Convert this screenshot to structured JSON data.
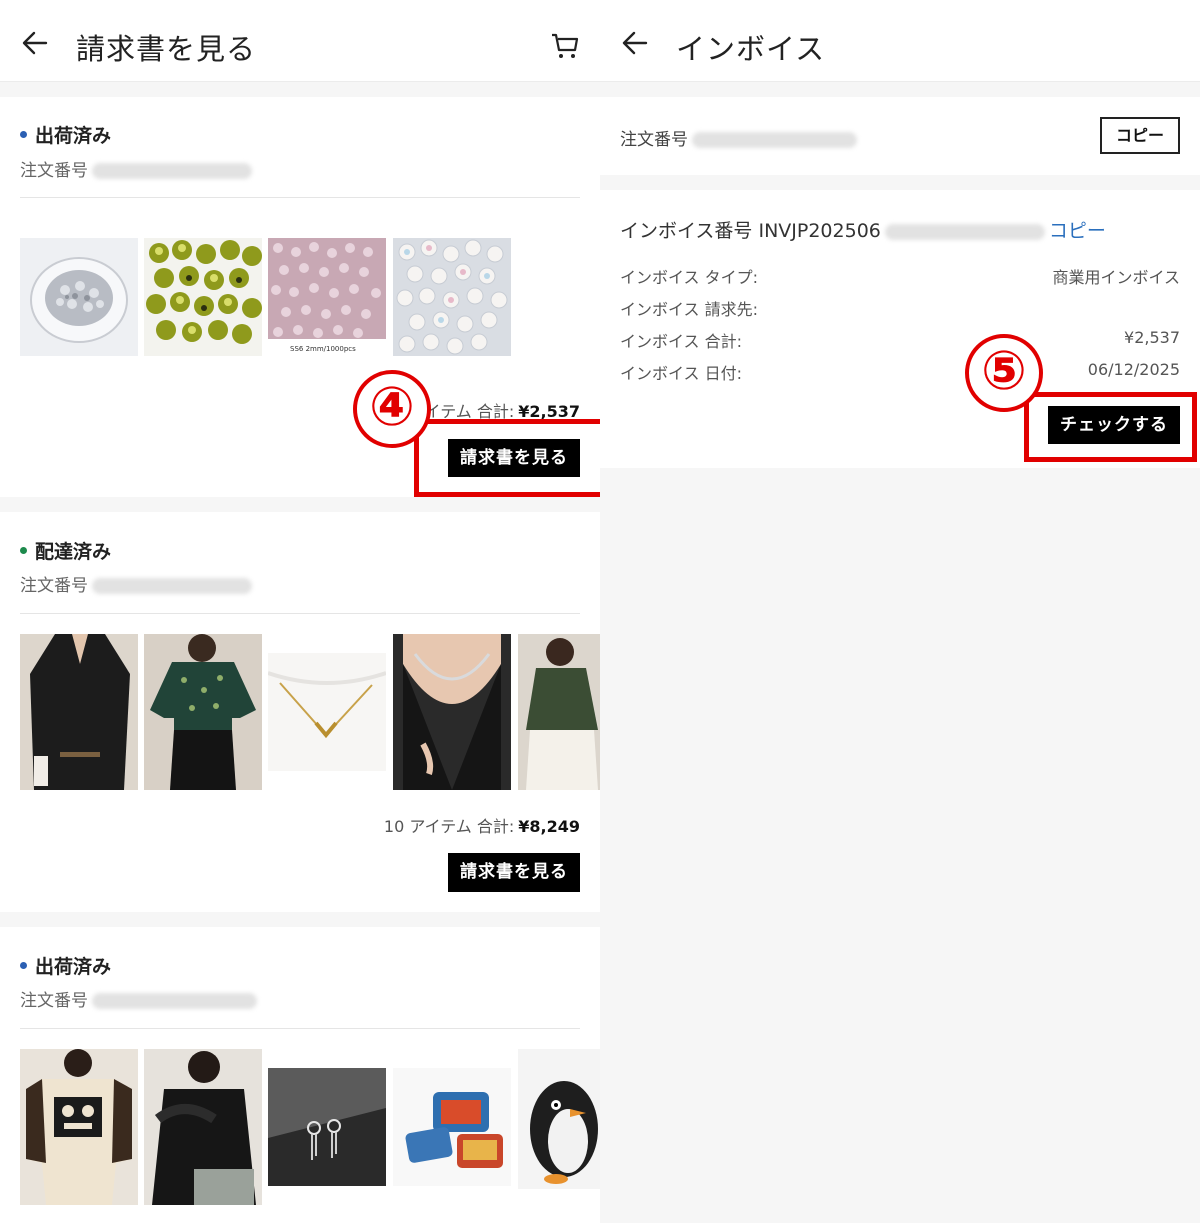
{
  "left_panel": {
    "title": "請求書を見る",
    "orders": [
      {
        "status": "出荷済み",
        "status_color": "#2b5fb3",
        "order_label": "注文番号",
        "items_label": "アイテム 合計:",
        "total": "¥2,537",
        "button": "請求書を見る",
        "annotation": "④"
      },
      {
        "status": "配達済み",
        "status_color": "#1d8a4c",
        "order_label": "注文番号",
        "items_label": "10 アイテム 合計:",
        "total": "¥8,249",
        "button": "請求書を見る"
      },
      {
        "status": "出荷済み",
        "status_color": "#2b5fb3",
        "order_label": "注文番号"
      }
    ],
    "image_caption": "SS6  2mm/1000pcs"
  },
  "right_panel": {
    "title": "インボイス",
    "order_label": "注文番号",
    "copy_button": "コピー",
    "invoice_number_label": "インボイス番号 INVJP202506",
    "invoice_copy_link": "コピー",
    "rows": [
      {
        "label": "インボイス タイプ:",
        "value": "商業用インボイス"
      },
      {
        "label": "インボイス 請求先:",
        "value": ""
      },
      {
        "label": "インボイス 合計:",
        "value": "¥2,537"
      },
      {
        "label": "インボイス 日付:",
        "value": "06/12/2025"
      }
    ],
    "check_button": "チェックする",
    "annotation": "⑤"
  },
  "colors": {
    "annotation_red": "#e10000",
    "link_blue": "#2a6fbd"
  }
}
